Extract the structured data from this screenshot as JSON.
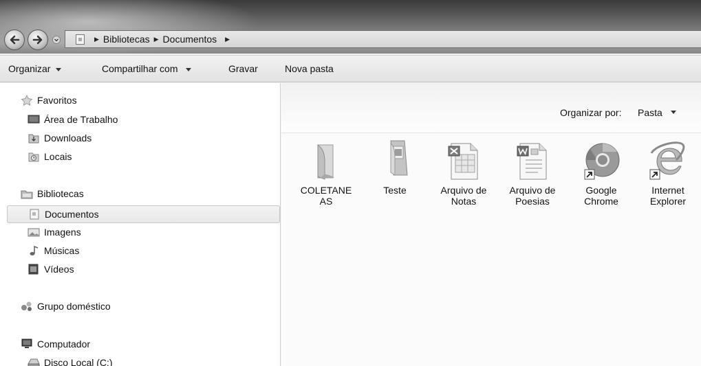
{
  "address": {
    "crumbs": [
      "Bibliotecas",
      "Documentos"
    ]
  },
  "toolbar": {
    "organize": "Organizar",
    "share": "Compartilhar com",
    "burn": "Gravar",
    "new_folder": "Nova pasta"
  },
  "sidebar": {
    "favorites": {
      "label": "Favoritos",
      "items": [
        "Área de Trabalho",
        "Downloads",
        "Locais"
      ]
    },
    "libraries": {
      "label": "Bibliotecas",
      "items": [
        "Documentos",
        "Imagens",
        "Músicas",
        "Vídeos"
      ],
      "selected": "Documentos"
    },
    "homegroup": {
      "label": "Grupo doméstico"
    },
    "computer": {
      "label": "Computador",
      "items": [
        "Disco Local (C:)"
      ]
    }
  },
  "content": {
    "arrange_label": "Organizar por:",
    "arrange_value": "Pasta",
    "files": [
      {
        "line1": "COLETANE",
        "line2": "AS",
        "icon": "folder-icon"
      },
      {
        "line1": "Teste",
        "line2": "",
        "icon": "folder-icon"
      },
      {
        "line1": "Arquivo de",
        "line2": "Notas",
        "icon": "excel-document-icon"
      },
      {
        "line1": "Arquivo de",
        "line2": "Poesias",
        "icon": "word-document-icon"
      },
      {
        "line1": "Google",
        "line2": "Chrome",
        "icon": "chrome-shortcut-icon"
      },
      {
        "line1": "Internet",
        "line2": "Explorer",
        "icon": "internet-explorer-shortcut-icon"
      }
    ]
  }
}
